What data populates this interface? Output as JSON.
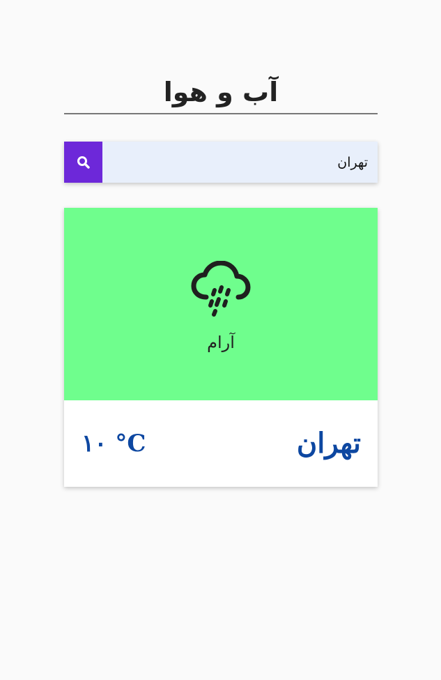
{
  "header": {
    "title": "آب و هوا"
  },
  "search": {
    "value": "تهران",
    "button_icon": "search-icon"
  },
  "weather": {
    "icon": "cloud-rain-icon",
    "condition": "آرام",
    "city": "تهران",
    "temperature": "۱۰ °C"
  },
  "colors": {
    "background": "#fafafa",
    "accent": "#6d28d9",
    "card_top": "#6ffe8d",
    "input_bg": "#e8effb",
    "text_blue": "#0d47a1"
  }
}
